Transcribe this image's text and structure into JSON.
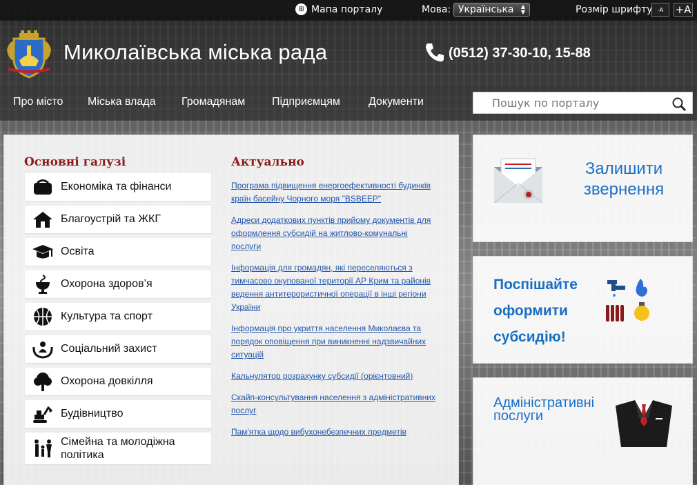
{
  "topbar": {
    "portal_map": "Мапа порталу",
    "lang_label": "Мова:",
    "lang_selected": "Українська",
    "font_label": "Розмір шрифту:",
    "font_small": "-A",
    "font_big": "+A"
  },
  "header": {
    "title": "Миколаївська міська рада",
    "phone": "(0512) 37-30-10, 15-88"
  },
  "nav": {
    "items": [
      "Про місто",
      "Міська влада",
      "Громадянам",
      "Підприємцям",
      "Документи"
    ]
  },
  "search": {
    "placeholder": "Пошук по порталу"
  },
  "sectors": {
    "title": "Основні галузі",
    "items": [
      "Економіка та фінанси",
      "Благоустрій та ЖКГ",
      "Освіта",
      "Охорона здоров’я",
      "Культура та спорт",
      "Соціальний захист",
      "Охорона довкілля",
      "Будівництво",
      "Сімейна та молодіжна політика"
    ]
  },
  "news": {
    "title": "Актуально",
    "items": [
      "Програма підвищення енергоефективності будинків країн  басейну Чорного моря \"BSBEEP\"",
      "Адреси додаткових пунктів прийому документів для оформлення субсидій на житлово-комунальні послуги",
      "Інформація для громадян, які переселяються з тимчасово окупованої території АР Крим та районів ведення антитерористичної операції в інші регіони України",
      "Інформація про укриття населення Миколаєва та порядок оповіщення при виникненні надзвичайних ситуацій",
      "Кальнулятор розрахунку субсидії (орієнтовний)",
      "Скайп-консультування населення з адміністративних послуг",
      "Пам'ятка щодо вибухонебезпечних предметів"
    ]
  },
  "cards": {
    "appeal": "Залишити звернення",
    "subsidy": "Поспішайте оформити субсидію!",
    "admin": "Адміністративні послуги"
  },
  "colors": {
    "accent": "#1a6fc4",
    "section_title": "#8b1a1a",
    "link": "#2255aa"
  }
}
